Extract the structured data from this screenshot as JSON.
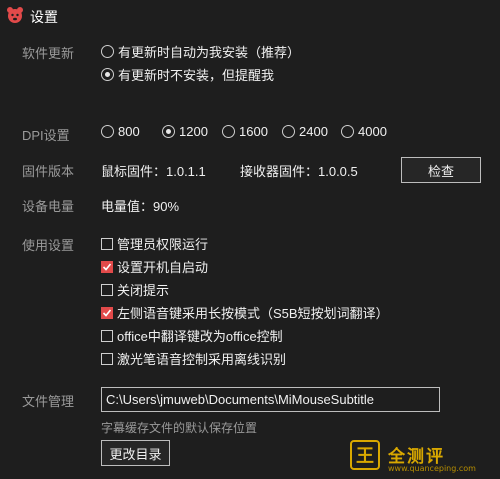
{
  "window": {
    "title": "设置",
    "icon": "bear-app-icon"
  },
  "software_update": {
    "label": "软件更新",
    "options": [
      {
        "label": "有更新时自动为我安装（推荐）",
        "selected": false
      },
      {
        "label": "有更新时不安装，但提醒我",
        "selected": true
      }
    ]
  },
  "dpi": {
    "label": "DPI设置",
    "options": [
      {
        "label": "800",
        "selected": false
      },
      {
        "label": "1200",
        "selected": true
      },
      {
        "label": "1600",
        "selected": false
      },
      {
        "label": "2400",
        "selected": false
      },
      {
        "label": "4000",
        "selected": false
      }
    ]
  },
  "firmware": {
    "label": "固件版本",
    "mouse": "鼠标固件：1.0.1.1",
    "receiver": "接收器固件：1.0.0.5",
    "check_button": "检查"
  },
  "battery": {
    "label": "设备电量",
    "value": "电量值：90%"
  },
  "usage": {
    "label": "使用设置",
    "options": [
      {
        "label": "管理员权限运行",
        "checked": false
      },
      {
        "label": "设置开机自启动",
        "checked": true
      },
      {
        "label": "关闭提示",
        "checked": false
      },
      {
        "label": "左侧语音键采用长按模式（S5B短按划词翻译）",
        "checked": true
      },
      {
        "label": "office中翻译键改为office控制",
        "checked": false
      },
      {
        "label": "激光笔语音控制采用离线识别",
        "checked": false
      }
    ]
  },
  "file_management": {
    "label": "文件管理",
    "path": "C:\\Users\\jmuweb\\Documents\\MiMouseSubtitle",
    "hint": "字幕缓存文件的默认保存位置",
    "change_button": "更改目录"
  },
  "watermark": {
    "logo_char": "王",
    "name": "全测评",
    "url": "www.quanceping.com"
  },
  "colors": {
    "accent": "#e24a4a",
    "background": "#1e1e1e",
    "watermark": "#d9a800"
  }
}
